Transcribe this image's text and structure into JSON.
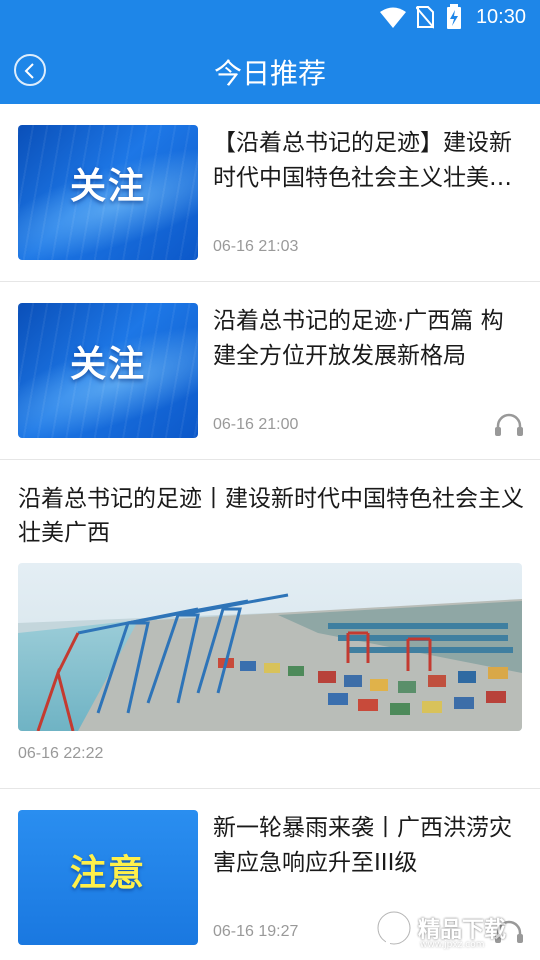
{
  "status_bar": {
    "time": "10:30",
    "icons": [
      "wifi-icon",
      "no-sim-icon",
      "battery-charging-icon"
    ]
  },
  "header": {
    "title": "今日推荐",
    "back_icon": "chevron-left-icon"
  },
  "colors": {
    "accent": "#1e86e8",
    "alert_tag": "#fff04a",
    "meta_text": "#999999"
  },
  "feed": [
    {
      "thumb_label": "关注",
      "title": "【沿着总书记的足迹】建设新时代中国特色社会主义壮美广西",
      "time": "06-16 21:03",
      "audio": false
    },
    {
      "thumb_label": "关注",
      "title": "沿着总书记的足迹·广西篇 构建全方位开放发展新格局",
      "time": "06-16 21:00",
      "audio": true
    },
    {
      "title": "沿着总书记的足迹丨建设新时代中国特色社会主义壮美广西",
      "time": "06-16 22:22",
      "image": "port-aerial-image"
    },
    {
      "thumb_label": "注意",
      "title": "新一轮暴雨来袭丨广西洪涝灾害应急响应升至III级",
      "time": "06-16 19:27",
      "audio": true
    }
  ],
  "watermark": {
    "text": "精品下载",
    "sub": "www.jpxz.com"
  }
}
